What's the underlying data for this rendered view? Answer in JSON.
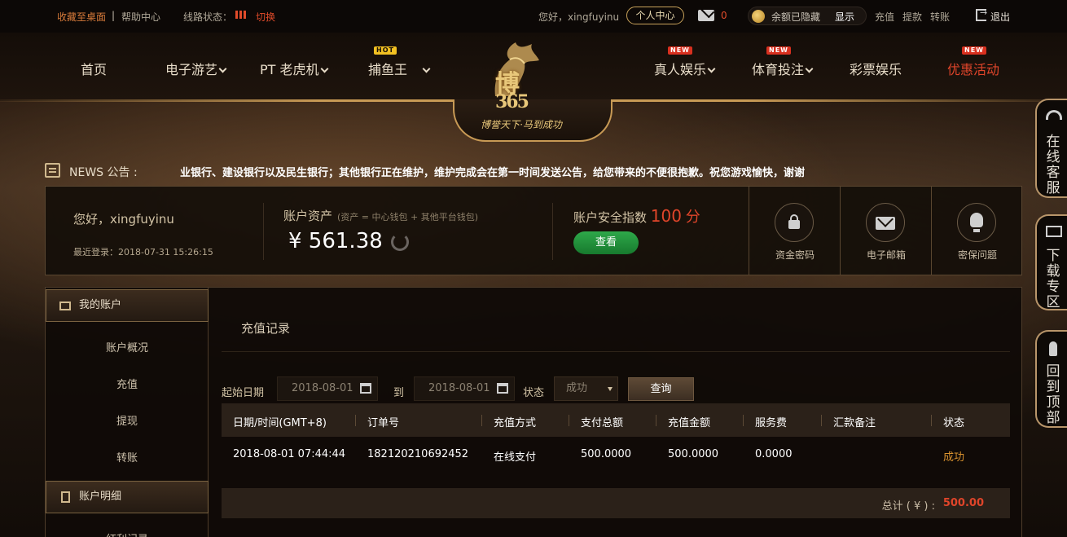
{
  "topbar": {
    "bookmark": "收藏至桌面",
    "separator": "|",
    "help": "帮助中心",
    "line_status_label": "线路状态：",
    "switch": "切换",
    "greeting": "您好，xingfuyinu",
    "personal_center": "个人中心",
    "mail_count": "0",
    "balance_hidden": "余额已隐藏",
    "show": "显示",
    "deposit": "充值",
    "withdraw": "提款",
    "transfer": "转账",
    "logout": "退出"
  },
  "nav": {
    "home": "首页",
    "egames": "电子游艺",
    "pt_slots": "PT 老虎机",
    "fishing": "捕鱼王",
    "live": "真人娱乐",
    "sports": "体育投注",
    "lottery": "彩票娱乐",
    "promotions": "优惠活动",
    "hot_badge": "HOT",
    "new_badge": "NEW"
  },
  "logo": {
    "name": "博",
    "number": "365",
    "slogan": "博誉天下·马到成功"
  },
  "news": {
    "label": "NEWS 公告 :",
    "text": "业银行、建设银行以及民生银行；其他银行正在维护，维护完成会在第一时间发送公告，给您带来的不便很抱歉。祝您游戏愉快，谢谢"
  },
  "summary": {
    "hello": "您好，xingfuyinu",
    "last_login": "最近登录：2018-07-31 15:26:15",
    "assets_title": "账户资产",
    "assets_sub": "(资产 = 中心钱包 + 其他平台钱包)",
    "assets_amount": "¥ 561.38",
    "safety_title": "账户安全指数",
    "safety_score": "100",
    "safety_unit": "分",
    "view": "查看",
    "fund_password": "资金密码",
    "email": "电子邮箱",
    "security_question": "密保问题"
  },
  "sidebar": {
    "my_account": "我的账户",
    "overview": "账户概况",
    "deposit": "充值",
    "withdraw": "提现",
    "transfer": "转账",
    "details": "账户明细",
    "bonus_records": "红利记录"
  },
  "content": {
    "title": "充值记录",
    "start_date_label": "起始日期",
    "start_date": "2018-08-01",
    "to_label": "到",
    "end_date": "2018-08-01",
    "status_label": "状态",
    "status_value": "成功",
    "query": "查询",
    "columns": [
      "日期/时间(GMT+8)",
      "订单号",
      "充值方式",
      "支付总额",
      "充值金额",
      "服务费",
      "汇款备注",
      "状态"
    ],
    "rows": [
      [
        "2018-08-01 07:44:44",
        "182120210692452",
        "在线支付",
        "500.0000",
        "500.0000",
        "0.0000",
        "",
        "成功"
      ]
    ],
    "total_label": "总计 ( ¥ ) :",
    "total_value": "500.00"
  },
  "float": {
    "service": "在线客服",
    "download": "下载专区",
    "top": "回到顶部"
  },
  "colors": {
    "accent_gold": "#c89a55",
    "alert_red": "#e0452a",
    "success_orange": "#d9922f",
    "button_green": "#2ea84a"
  }
}
